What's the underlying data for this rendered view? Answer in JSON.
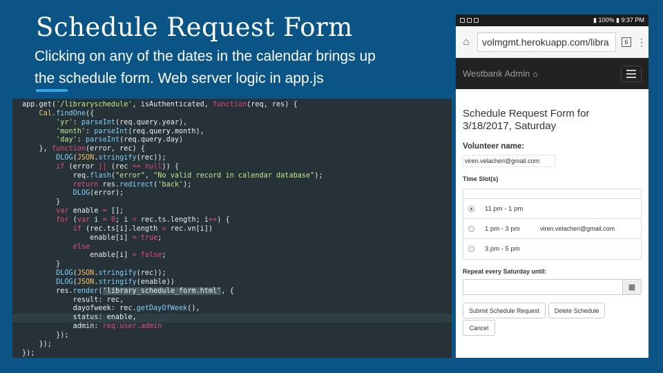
{
  "slide": {
    "title": "Schedule Request Form",
    "subtitle_line1": "Clicking on any of the dates in the calendar brings up",
    "subtitle_line2": "the schedule form. Web server logic in app.js"
  },
  "code_lines": [
    {
      "hl": false,
      "tokens": [
        {
          "t": "app",
          "c": "var"
        },
        {
          "t": ".get(",
          "c": "var"
        },
        {
          "t": "'/libraryschedule'",
          "c": "str"
        },
        {
          "t": ", isAuthenticated, ",
          "c": "var"
        },
        {
          "t": "function",
          "c": "kw"
        },
        {
          "t": "(req, res) {",
          "c": "var"
        }
      ]
    },
    {
      "hl": false,
      "tokens": [
        {
          "t": "    ",
          "c": "var"
        },
        {
          "t": "Cal",
          "c": "obj"
        },
        {
          "t": ".",
          "c": "var"
        },
        {
          "t": "findOne",
          "c": "fn"
        },
        {
          "t": "({",
          "c": "var"
        }
      ]
    },
    {
      "hl": false,
      "tokens": [
        {
          "t": "        ",
          "c": "var"
        },
        {
          "t": "'yr'",
          "c": "str"
        },
        {
          "t": ": ",
          "c": "var"
        },
        {
          "t": "parseInt",
          "c": "fn"
        },
        {
          "t": "(req.query.year),",
          "c": "var"
        }
      ]
    },
    {
      "hl": false,
      "tokens": [
        {
          "t": "        ",
          "c": "var"
        },
        {
          "t": "'month'",
          "c": "str"
        },
        {
          "t": ": ",
          "c": "var"
        },
        {
          "t": "parseInt",
          "c": "fn"
        },
        {
          "t": "(req.query.month),",
          "c": "var"
        }
      ]
    },
    {
      "hl": false,
      "tokens": [
        {
          "t": "        ",
          "c": "var"
        },
        {
          "t": "'day'",
          "c": "str"
        },
        {
          "t": ": ",
          "c": "var"
        },
        {
          "t": "parseInt",
          "c": "fn"
        },
        {
          "t": "(req.query.day)",
          "c": "var"
        }
      ]
    },
    {
      "hl": false,
      "tokens": [
        {
          "t": "    }, ",
          "c": "var"
        },
        {
          "t": "function",
          "c": "kw"
        },
        {
          "t": "(error, rec) {",
          "c": "var"
        }
      ]
    },
    {
      "hl": false,
      "tokens": [
        {
          "t": "        ",
          "c": "var"
        },
        {
          "t": "DLOG",
          "c": "fn"
        },
        {
          "t": "(",
          "c": "var"
        },
        {
          "t": "JSON",
          "c": "obj"
        },
        {
          "t": ".",
          "c": "var"
        },
        {
          "t": "stringify",
          "c": "fn"
        },
        {
          "t": "(rec));",
          "c": "var"
        }
      ]
    },
    {
      "hl": false,
      "tokens": [
        {
          "t": "        ",
          "c": "var"
        },
        {
          "t": "if",
          "c": "kw"
        },
        {
          "t": " (error ",
          "c": "var"
        },
        {
          "t": "||",
          "c": "kw"
        },
        {
          "t": " (rec ",
          "c": "var"
        },
        {
          "t": "==",
          "c": "kw"
        },
        {
          "t": " ",
          "c": "var"
        },
        {
          "t": "null",
          "c": "kw"
        },
        {
          "t": ")) {",
          "c": "var"
        }
      ]
    },
    {
      "hl": false,
      "tokens": [
        {
          "t": "            req.",
          "c": "var"
        },
        {
          "t": "flash",
          "c": "fn"
        },
        {
          "t": "(",
          "c": "var"
        },
        {
          "t": "\"error\"",
          "c": "str"
        },
        {
          "t": ", ",
          "c": "var"
        },
        {
          "t": "\"No valid record in calendar database\"",
          "c": "str"
        },
        {
          "t": ");",
          "c": "var"
        }
      ]
    },
    {
      "hl": false,
      "tokens": [
        {
          "t": "            ",
          "c": "var"
        },
        {
          "t": "return",
          "c": "kw"
        },
        {
          "t": " res.",
          "c": "var"
        },
        {
          "t": "redirect",
          "c": "fn"
        },
        {
          "t": "(",
          "c": "var"
        },
        {
          "t": "'back'",
          "c": "str"
        },
        {
          "t": ");",
          "c": "var"
        }
      ]
    },
    {
      "hl": false,
      "tokens": [
        {
          "t": "            ",
          "c": "var"
        },
        {
          "t": "DLOG",
          "c": "fn"
        },
        {
          "t": "(error);",
          "c": "var"
        }
      ]
    },
    {
      "hl": false,
      "tokens": [
        {
          "t": "        }",
          "c": "var"
        }
      ]
    },
    {
      "hl": false,
      "tokens": [
        {
          "t": "        ",
          "c": "var"
        },
        {
          "t": "var",
          "c": "kw"
        },
        {
          "t": " enable ",
          "c": "var"
        },
        {
          "t": "=",
          "c": "kw"
        },
        {
          "t": " [];",
          "c": "var"
        }
      ]
    },
    {
      "hl": false,
      "tokens": [
        {
          "t": "        ",
          "c": "var"
        },
        {
          "t": "for",
          "c": "kw"
        },
        {
          "t": " (",
          "c": "var"
        },
        {
          "t": "var",
          "c": "kw"
        },
        {
          "t": " i ",
          "c": "var"
        },
        {
          "t": "=",
          "c": "kw"
        },
        {
          "t": " ",
          "c": "var"
        },
        {
          "t": "0",
          "c": "num"
        },
        {
          "t": "; i ",
          "c": "var"
        },
        {
          "t": "<",
          "c": "kw"
        },
        {
          "t": " rec.ts.length; i",
          "c": "var"
        },
        {
          "t": "++",
          "c": "kw"
        },
        {
          "t": ") {",
          "c": "var"
        }
      ]
    },
    {
      "hl": false,
      "tokens": [
        {
          "t": "            ",
          "c": "var"
        },
        {
          "t": "if",
          "c": "kw"
        },
        {
          "t": " (rec.ts[i].length ",
          "c": "var"
        },
        {
          "t": "<",
          "c": "kw"
        },
        {
          "t": " rec.vn[i])",
          "c": "var"
        }
      ]
    },
    {
      "hl": false,
      "tokens": [
        {
          "t": "                enable[i] ",
          "c": "var"
        },
        {
          "t": "=",
          "c": "kw"
        },
        {
          "t": " ",
          "c": "var"
        },
        {
          "t": "true",
          "c": "kw"
        },
        {
          "t": ";",
          "c": "var"
        }
      ]
    },
    {
      "hl": false,
      "tokens": [
        {
          "t": "            ",
          "c": "var"
        },
        {
          "t": "else",
          "c": "kw"
        }
      ]
    },
    {
      "hl": false,
      "tokens": [
        {
          "t": "                enable[i] ",
          "c": "var"
        },
        {
          "t": "=",
          "c": "kw"
        },
        {
          "t": " ",
          "c": "var"
        },
        {
          "t": "false",
          "c": "kw"
        },
        {
          "t": ";",
          "c": "var"
        }
      ]
    },
    {
      "hl": false,
      "tokens": [
        {
          "t": "        }",
          "c": "var"
        }
      ]
    },
    {
      "hl": false,
      "tokens": [
        {
          "t": "        ",
          "c": "var"
        },
        {
          "t": "DLOG",
          "c": "fn"
        },
        {
          "t": "(",
          "c": "var"
        },
        {
          "t": "JSON",
          "c": "obj"
        },
        {
          "t": ".",
          "c": "var"
        },
        {
          "t": "stringify",
          "c": "fn"
        },
        {
          "t": "(rec));",
          "c": "var"
        }
      ]
    },
    {
      "hl": false,
      "tokens": [
        {
          "t": "        ",
          "c": "var"
        },
        {
          "t": "DLOG",
          "c": "fn"
        },
        {
          "t": "(",
          "c": "var"
        },
        {
          "t": "JSON",
          "c": "obj"
        },
        {
          "t": ".",
          "c": "var"
        },
        {
          "t": "stringify",
          "c": "fn"
        },
        {
          "t": "(enable))",
          "c": "var"
        }
      ]
    },
    {
      "hl": false,
      "tokens": [
        {
          "t": "        res.",
          "c": "var"
        },
        {
          "t": "render",
          "c": "fn"
        },
        {
          "t": "(",
          "c": "var"
        },
        {
          "t": "'library_schedule_form.html'",
          "c": "hlstr"
        },
        {
          "t": ", {",
          "c": "var"
        }
      ]
    },
    {
      "hl": false,
      "tokens": [
        {
          "t": "            result: rec,",
          "c": "var"
        }
      ]
    },
    {
      "hl": false,
      "tokens": [
        {
          "t": "            dayofweek: rec.",
          "c": "var"
        },
        {
          "t": "getDayOfWeek",
          "c": "fn"
        },
        {
          "t": "(),",
          "c": "var"
        }
      ]
    },
    {
      "hl": true,
      "tokens": [
        {
          "t": "            status: enable,",
          "c": "var"
        }
      ]
    },
    {
      "hl": false,
      "tokens": [
        {
          "t": "            admin: ",
          "c": "var"
        },
        {
          "t": "req.user.admin",
          "c": "kw"
        }
      ]
    },
    {
      "hl": false,
      "tokens": [
        {
          "t": "        });",
          "c": "var"
        }
      ]
    },
    {
      "hl": false,
      "tokens": [
        {
          "t": "    });",
          "c": "var"
        }
      ]
    },
    {
      "hl": false,
      "tokens": [
        {
          "t": "});",
          "c": "var"
        }
      ]
    }
  ],
  "colors": {
    "kw": "#e04d7a",
    "fn": "#7fd0f7",
    "str": "#c3e88d",
    "obj": "#f5c26b",
    "var": "#e8eef0",
    "num": "#e04d7a"
  },
  "phone": {
    "status_time": "9:37 PM",
    "status_battery": "100%",
    "url": "volmgmt.herokuapp.com/libra",
    "tab_count": "6",
    "brand": "Westbank Admin",
    "brand_icon": "home-icon",
    "form_title_line1": "Schedule Request Form for",
    "form_title_line2": "3/18/2017, Saturday",
    "volunteer_label": "Volunteer name:",
    "volunteer_value": "viren.velacheri@gmail.com",
    "time_slot_label": "Time Slot(s)",
    "slots": [
      {
        "time": "11 pm - 1 pm",
        "volunteer": "",
        "selected": true
      },
      {
        "time": "1 pm - 3 pm",
        "volunteer": "viren.velacheri@gmail.com",
        "selected": false
      },
      {
        "time": "3 pm - 5 pm",
        "volunteer": "",
        "selected": false
      }
    ],
    "repeat_label": "Repeat every Saturday until:",
    "submit_label": "Submit Schedule Request",
    "delete_label": "Delete Schedule",
    "cancel_label": "Cancel"
  }
}
